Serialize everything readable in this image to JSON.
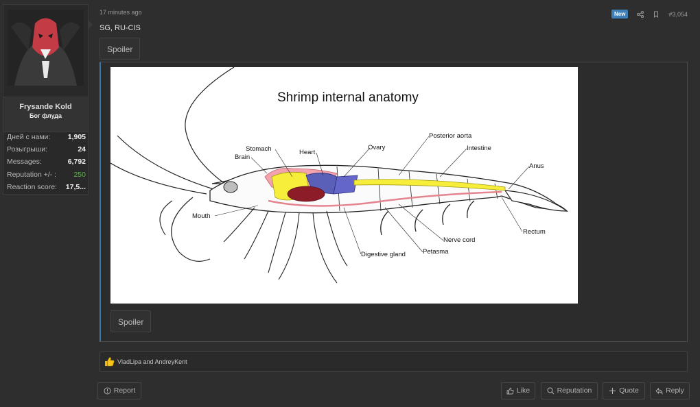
{
  "user": {
    "name": "Frysande Kold",
    "title": "Бог флуда",
    "stats": [
      {
        "label": "Дней с нами:",
        "value": "1,905"
      },
      {
        "label": "Розыгрыши:",
        "value": "24"
      },
      {
        "label": "Messages:",
        "value": "6,792"
      },
      {
        "label": "Reputation +/- :",
        "value": "250",
        "color": "#5fb34a"
      },
      {
        "label": "Reaction score:",
        "value": "17,5..."
      }
    ]
  },
  "post": {
    "time": "17 minutes ago",
    "badge": "New",
    "number": "#3,054",
    "text": "SG, RU-CIS",
    "spoiler_label": "Spoiler",
    "inner_spoiler_label": "Spoiler"
  },
  "image": {
    "title": "Shrimp internal anatomy",
    "labels": {
      "stomach": "Stomach",
      "brain": "Brain",
      "heart": "Heart",
      "ovary": "Ovary",
      "posterior_aorta": "Posterior aorta",
      "intestine": "Intestine",
      "anus": "Anus",
      "mouth": "Mouth",
      "rectum": "Rectum",
      "nerve_cord": "Nerve cord",
      "petasma": "Petasma",
      "digestive_gland": "Digestive gland"
    }
  },
  "reactions": {
    "text": "VladLipa and AndreyKent"
  },
  "footer": {
    "report": "Report",
    "like": "Like",
    "reputation": "Reputation",
    "quote": "Quote",
    "reply": "Reply"
  },
  "colors": {
    "accent": "#3d7fb6",
    "reputation": "#5fb34a",
    "background": "#2e2e2e"
  }
}
